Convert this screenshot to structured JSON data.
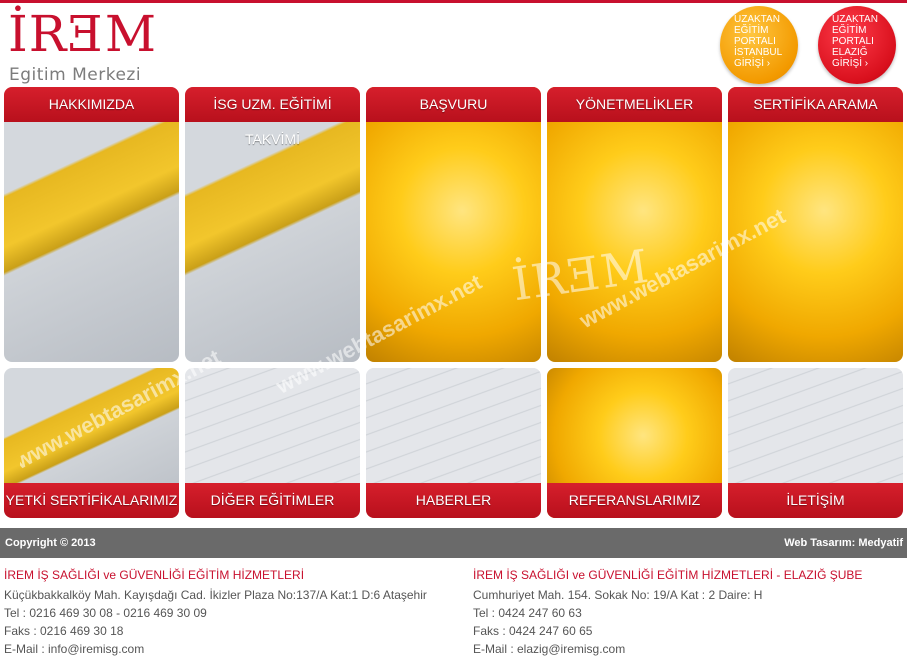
{
  "brand": {
    "logo_text": "İRƎM",
    "logo_sub": "Egitim Merkezi"
  },
  "portals": [
    {
      "label": "UZAKTAN EĞİTİM PORTALI İSTANBUL GİRİŞİ ›",
      "color": "#f39a00"
    },
    {
      "label": "UZAKTAN EĞİTİM PORTALI ELAZIĞ GİRİŞİ ›",
      "color": "#d9101d"
    }
  ],
  "nav_top": [
    "HAKKIMIZDA",
    "İSG UZM. EĞİTİMİ TAKVİMİ",
    "BAŞVURU",
    "YÖNETMELİKLER",
    "SERTİFİKA ARAMA"
  ],
  "nav_bottom": [
    "YETKİ SERTİFİKALARIMIZ",
    "DİĞER EĞİTİMLER",
    "HABERLER",
    "REFERANSLARIMIZ",
    "İLETİŞİM"
  ],
  "watermark_text": "www.webtasarimx.net",
  "image_logo_text": "İRƎM",
  "footer": {
    "copyright": "Copyright © 2013",
    "credit": "Web Tasarım: Medyatif"
  },
  "addresses": {
    "istanbul": {
      "heading": "İREM İŞ SAĞLIĞI ve GÜVENLİĞİ EĞİTİM HİZMETLERİ",
      "address": "Küçükbakkalköy Mah. Kayışdağı Cad. İkizler Plaza No:137/A Kat:1 D:6 Ataşehir",
      "tel": "Tel : 0216 469 30 08 - 0216 469 30 09",
      "fax": "Faks : 0216 469 30 18",
      "email": "E-Mail : info@iremisg.com"
    },
    "elazig": {
      "heading": "İREM İŞ SAĞLIĞI ve GÜVENLİĞİ EĞİTİM HİZMETLERİ - ELAZIĞ ŞUBE",
      "address": "Cumhuriyet Mah. 154. Sokak No: 19/A Kat : 2 Daire: H",
      "tel": "Tel : 0424 247 60 63",
      "fax": "Faks : 0424 247 60 65",
      "email": "E-Mail : elazig@iremisg.com"
    }
  },
  "colors": {
    "brand_red": "#c8102e",
    "footer_gray": "#6a6a6a",
    "portal_orange": "#f39a00",
    "portal_red": "#d9101d"
  }
}
